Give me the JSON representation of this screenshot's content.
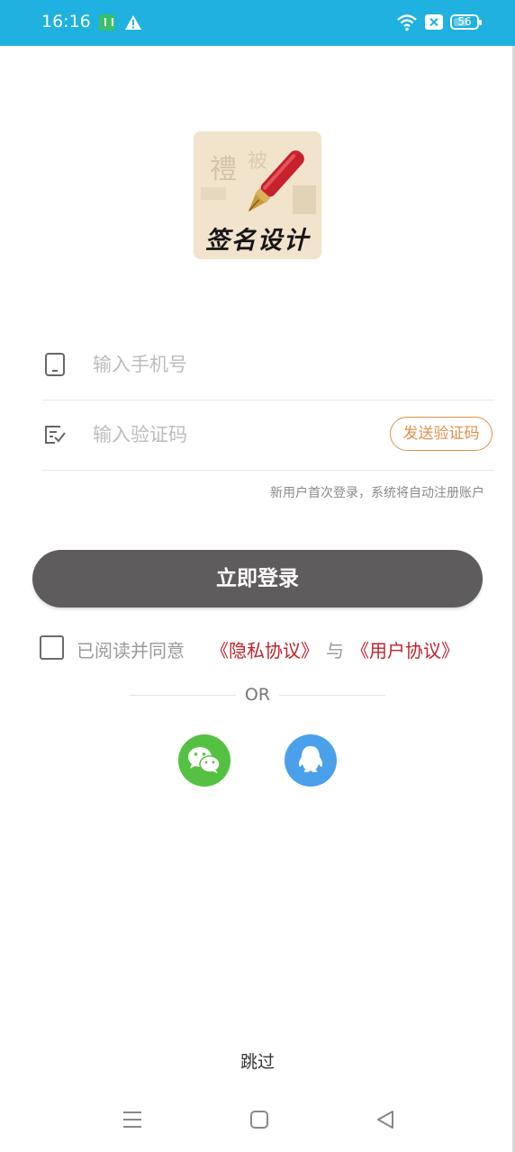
{
  "status_bar": {
    "time": "16:16",
    "battery": "56",
    "icons": [
      "app-notification-icon",
      "warning-icon",
      "wifi-icon",
      "no-sim-icon",
      "battery-icon"
    ],
    "background_color": "#1fb1e0"
  },
  "logo": {
    "text": "签名设计",
    "icon": "fountain-pen-icon"
  },
  "form": {
    "phone": {
      "icon": "phone-icon",
      "placeholder": "输入手机号",
      "value": ""
    },
    "code": {
      "icon": "verify-code-icon",
      "placeholder": "输入验证码",
      "value": "",
      "send_label": "发送验证码"
    },
    "hint": "新用户首次登录，系统将自动注册账户"
  },
  "login_button": {
    "label": "立即登录",
    "color": "#5e5c5d"
  },
  "agreement": {
    "checked": false,
    "prefix": "已阅读并同意",
    "privacy_link": "《隐私协议》",
    "and": "与",
    "user_link": "《用户协议》",
    "link_color": "#c0222c"
  },
  "divider": {
    "label": "OR"
  },
  "social_login": [
    {
      "name": "wechat",
      "icon": "wechat-icon",
      "color": "#55c142"
    },
    {
      "name": "qq",
      "icon": "qq-icon",
      "color": "#4aa0ea"
    }
  ],
  "skip_label": "跳过",
  "nav_bar": {
    "buttons": [
      "menu-icon",
      "home-icon",
      "back-icon"
    ]
  },
  "accent_color": "#e0904a"
}
